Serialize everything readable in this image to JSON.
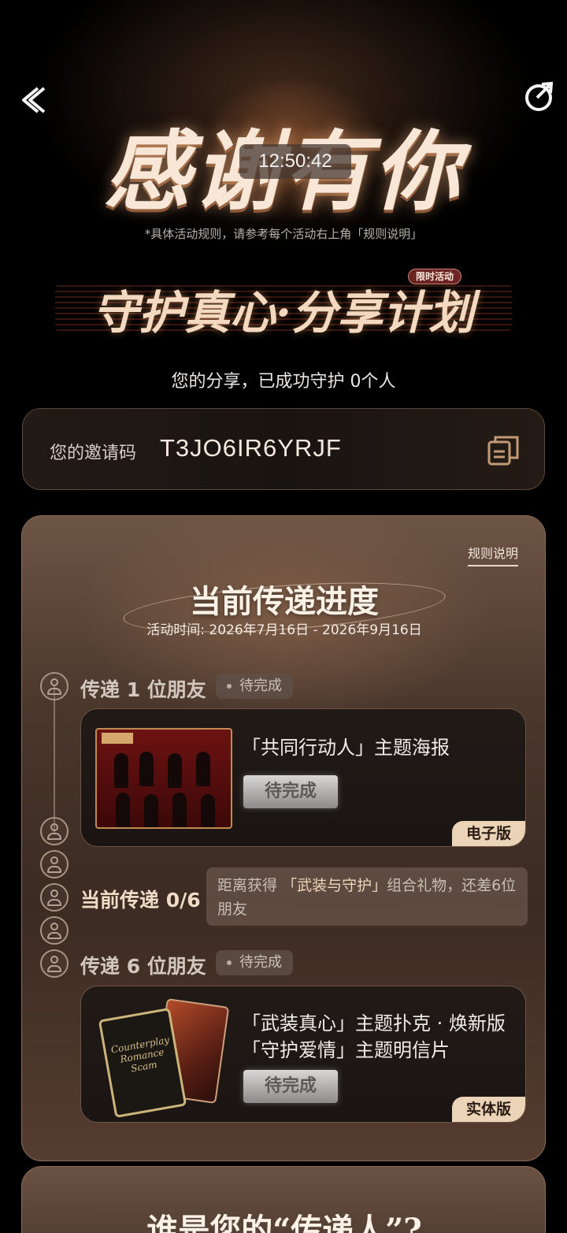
{
  "hero": {
    "title": "感谢有你",
    "clock": "12:50:42",
    "rule_note": "*具体活动规则，请参考每个活动右上角「规则说明」",
    "campaign_title": "守护真心·分享计划",
    "limited_badge": "限时活动",
    "protected_text": "您的分享，已成功守护 0个人"
  },
  "invite": {
    "label": "您的邀请码",
    "code": "T3JO6IR6YRJF"
  },
  "progress": {
    "rules_link": "规则说明",
    "title": "当前传递进度",
    "event_time": "活动时间: 2026年7月16日 - 2026年9月16日",
    "step1": {
      "label": "传递 1 位朋友",
      "status": "待完成",
      "reward": "「共同行动人」主题海报",
      "button": "待完成",
      "version": "电子版"
    },
    "current": {
      "label": "当前传递 0/6",
      "info_prefix": "距离获得",
      "info_highlight": "「武装与守护」",
      "info_suffix": "组合礼物，还差6位朋友"
    },
    "step2": {
      "label": "传递 6 位朋友",
      "status": "待完成",
      "reward_line1": "「武装真心」主题扑克 · 焕新版",
      "reward_line2": "「守护爱情」主题明信片",
      "button": "待完成",
      "version": "实体版"
    },
    "card_art_text": "Counterplay Romance Scam"
  },
  "next_section": {
    "title": "谁是您的“传递人”?"
  },
  "colors": {
    "accent_gold": "#ead3b7",
    "card_brown": "#4a372c",
    "background": "#000000"
  },
  "icons": [
    "back-icon",
    "share-icon",
    "copy-icon",
    "person-icon"
  ]
}
